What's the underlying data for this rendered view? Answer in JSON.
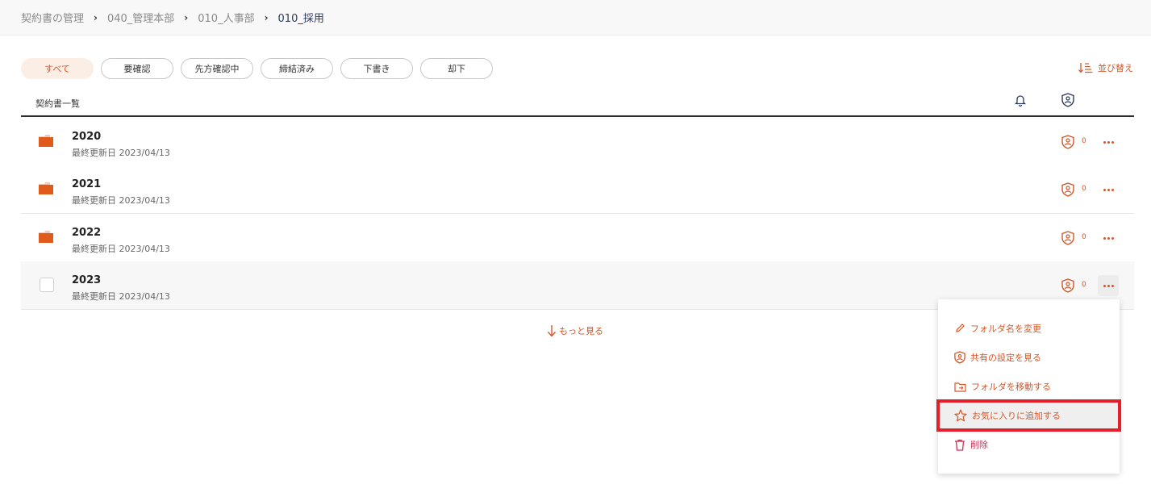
{
  "breadcrumb": [
    {
      "label": "契約書の管理"
    },
    {
      "label": "040_管理本部"
    },
    {
      "label": "010_人事部"
    },
    {
      "label": "010_採用"
    }
  ],
  "filters": [
    {
      "label": "すべて",
      "active": true
    },
    {
      "label": "要確認"
    },
    {
      "label": "先方確認中"
    },
    {
      "label": "締結済み"
    },
    {
      "label": "下書き"
    },
    {
      "label": "却下"
    }
  ],
  "sort": {
    "label": "並び替え"
  },
  "list": {
    "title": "契約書一覧",
    "rows": [
      {
        "name": "2020",
        "updated": "最終更新日 2023/04/13",
        "share_count": "0"
      },
      {
        "name": "2021",
        "updated": "最終更新日 2023/04/13",
        "share_count": "0"
      },
      {
        "name": "2022",
        "updated": "最終更新日 2023/04/13",
        "share_count": "0"
      },
      {
        "name": "2023",
        "updated": "最終更新日 2023/04/13",
        "share_count": "0"
      }
    ],
    "load_more": "もっと見る"
  },
  "context_menu": {
    "items": [
      {
        "label": "フォルダ名を変更",
        "icon": "pencil-icon"
      },
      {
        "label": "共有の設定を見る",
        "icon": "share-shield-icon"
      },
      {
        "label": "フォルダを移動する",
        "icon": "folder-move-icon"
      },
      {
        "label": "お気に入りに追加する",
        "icon": "star-icon",
        "highlighted": true
      },
      {
        "label": "削除",
        "icon": "trash-icon"
      }
    ]
  },
  "colors": {
    "accent": "#d4572a",
    "folder": "#e05a1c",
    "highlight_frame": "#e3202a",
    "delete": "#d42a55"
  }
}
